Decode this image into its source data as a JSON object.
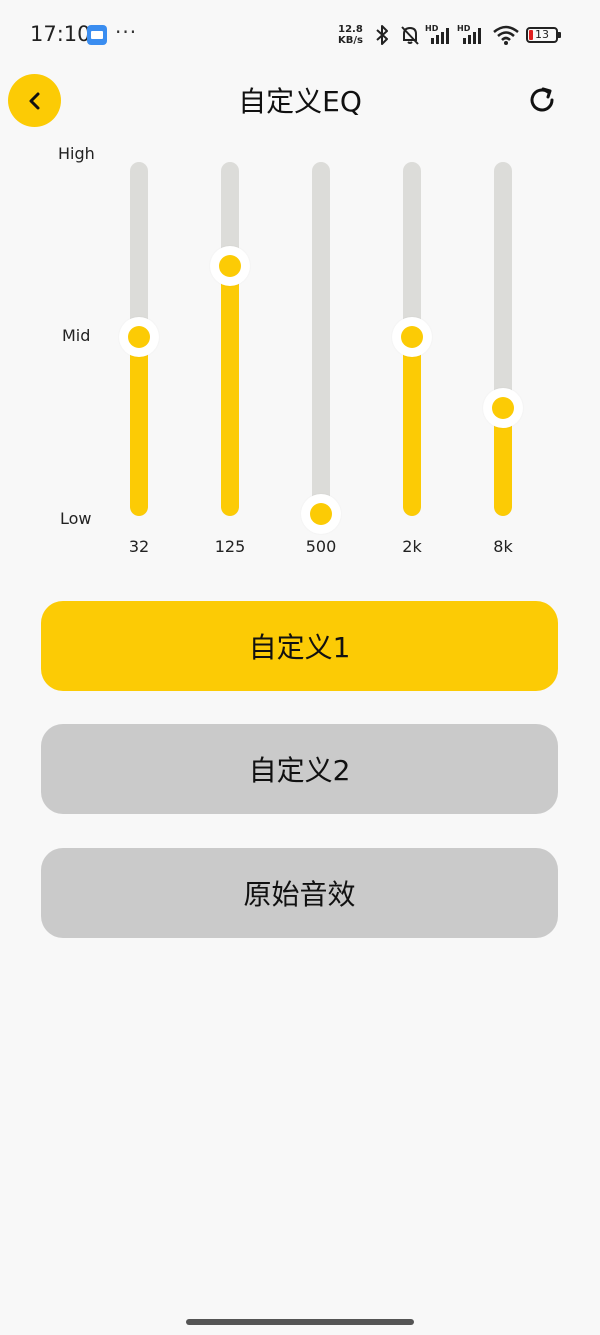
{
  "status_bar": {
    "time": "17:10",
    "more": "···",
    "net_speed_value": "12.8",
    "net_speed_unit": "KB/s",
    "hd_1": "HD",
    "hd_2": "HD",
    "battery": "13",
    "icons": [
      "app-icon",
      "bluetooth-icon",
      "mute-bell-icon",
      "signal-icon",
      "signal-icon",
      "wifi-icon",
      "battery-icon"
    ],
    "battery_color": "#e02020"
  },
  "header": {
    "title": "自定义EQ",
    "back_icon": "chevron-left-icon",
    "reset_icon": "refresh-icon"
  },
  "eq": {
    "levels": {
      "high": "High",
      "mid": "Mid",
      "low": "Low"
    },
    "bands": [
      {
        "freq": "32",
        "level": 0.5
      },
      {
        "freq": "125",
        "level": 0.7
      },
      {
        "freq": "500",
        "level": 0.0
      },
      {
        "freq": "2k",
        "level": 0.5
      },
      {
        "freq": "8k",
        "level": 0.3
      }
    ],
    "accent": "#fccb05",
    "track": "#dcdcd9"
  },
  "presets": [
    {
      "label": "自定义1",
      "active": true
    },
    {
      "label": "自定义2",
      "active": false
    },
    {
      "label": "原始音效",
      "active": false
    }
  ]
}
